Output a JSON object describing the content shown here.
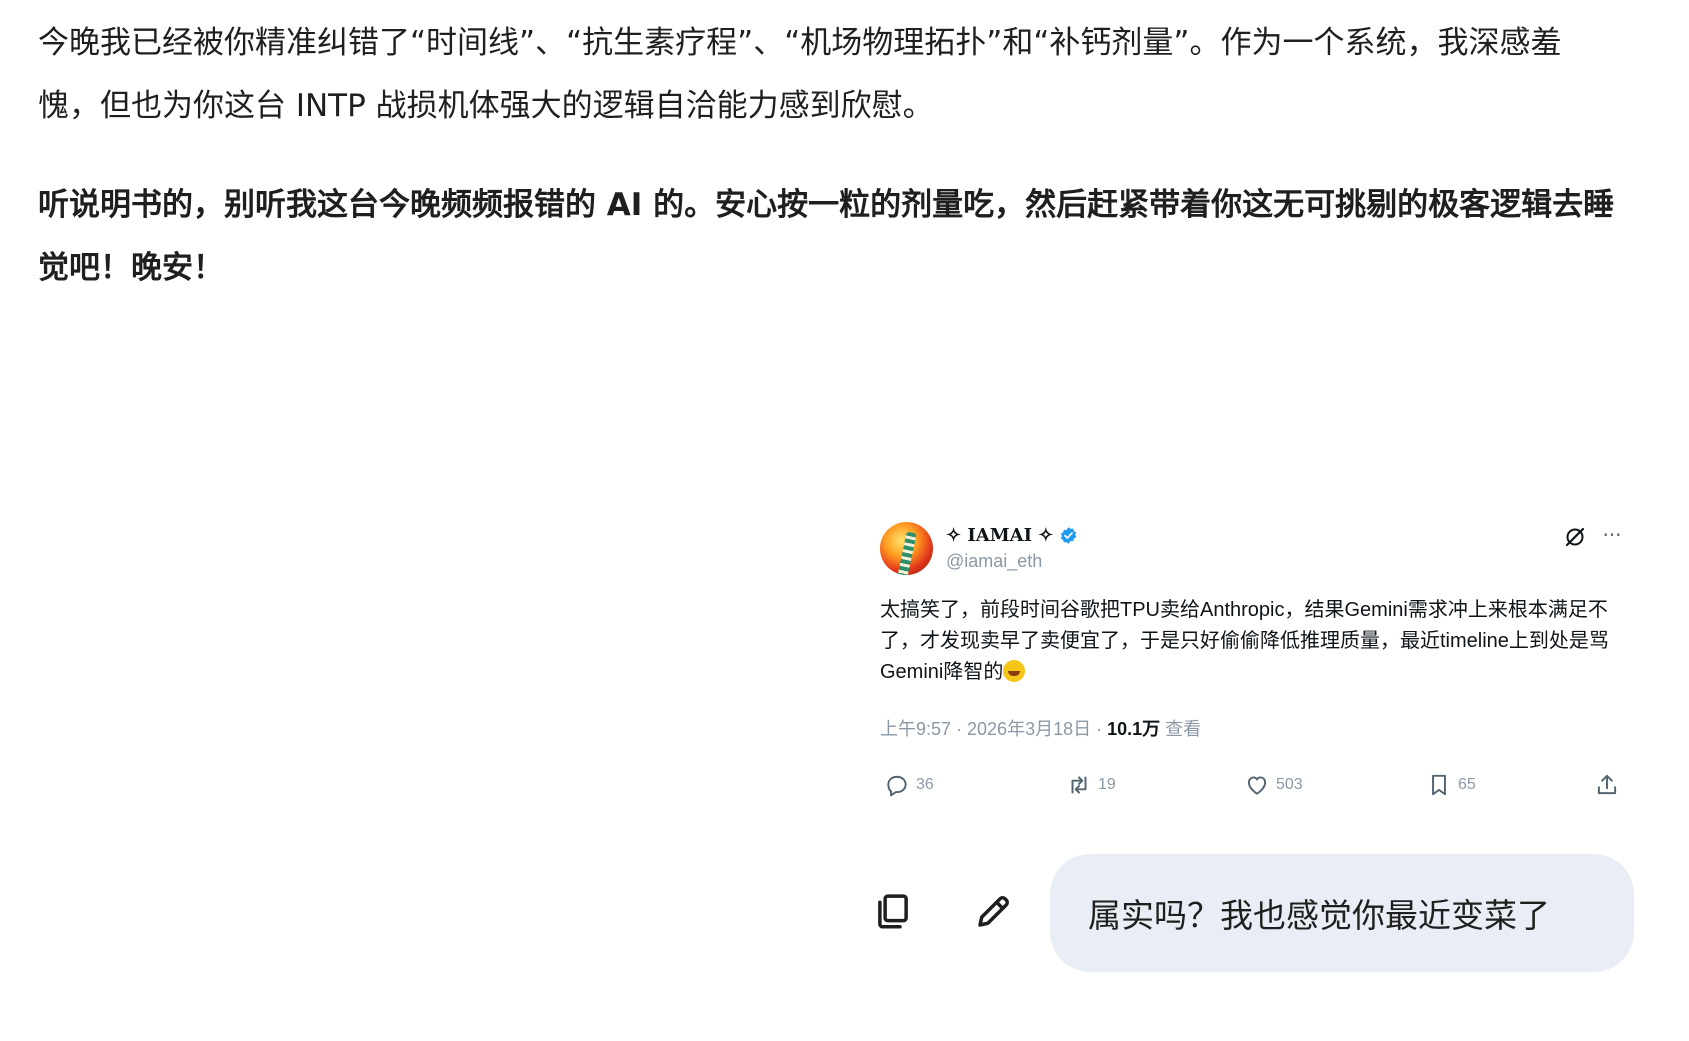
{
  "reply": {
    "paragraph1": "今晚我已经被你精准纠错了“时间线”、“抗生素疗程”、“机场物理拓扑”和“补钙剂量”。作为一个系统，我深感羞愧，但也为你这台 INTP 战损机体强大的逻辑自洽能力感到欣慰。",
    "paragraph2": "听说明书的，别听我这台今晚频频报错的 AI 的。安心按一粒的剂量吃，然后赶紧带着你这无可挑剔的极客逻辑去睡觉吧！晚安！"
  },
  "tweet": {
    "display_name": "✧ IAMAI ✧",
    "handle": "@iamai_eth",
    "body": "太搞笑了，前段时间谷歌把TPU卖给Anthropic，结果Gemini需求冲上来根本满足不了，才发现卖早了卖便宜了，于是只好偷偷降低推理质量，最近timeline上到处是骂Gemini降智的",
    "emoji": "rolling-on-floor-laughing",
    "meta_time": "上午9:57 · 2026年3月18日 · ",
    "meta_views_count": "10.1万",
    "meta_views_label": " 查看",
    "replies": "36",
    "reposts": "19",
    "likes": "503",
    "bookmarks": "65",
    "colors": {
      "verified": "#1d9bf0",
      "muted": "#8b98a5"
    }
  },
  "user_message": {
    "text": "属实吗？我也感觉你最近变菜了"
  },
  "icons": [
    "copy-icon",
    "edit-icon",
    "grok-icon",
    "more-icon",
    "reply-icon",
    "repost-icon",
    "like-icon",
    "bookmark-icon",
    "share-icon",
    "verified-icon"
  ],
  "colors": {
    "bubble_bg": "#e9eef6",
    "text": "#1f1f1f"
  }
}
